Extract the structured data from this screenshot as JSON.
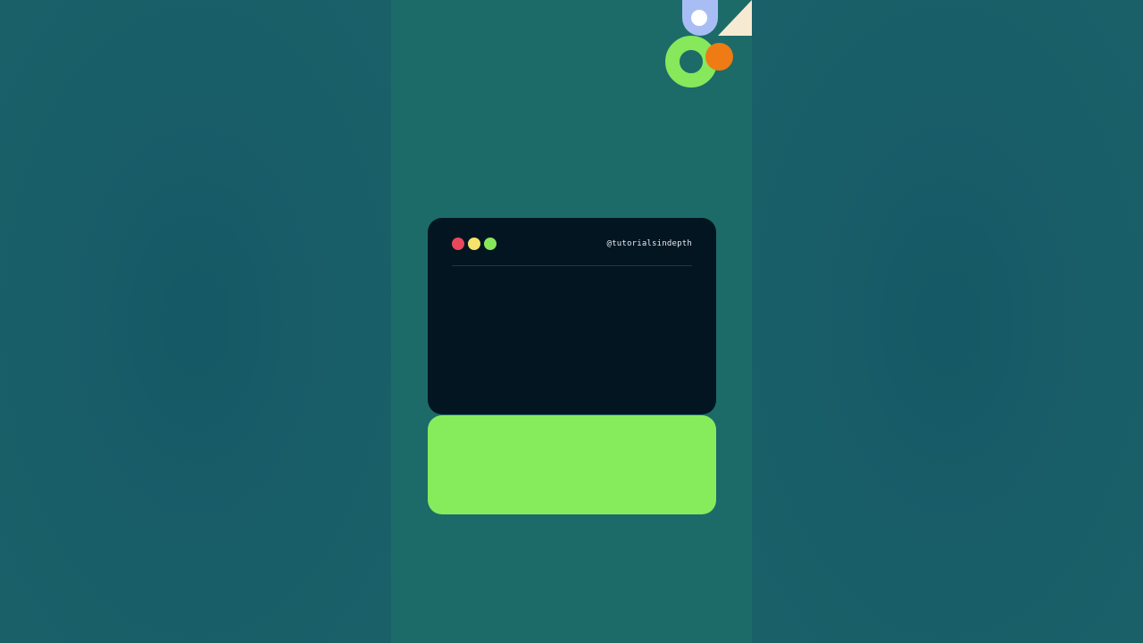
{
  "terminal": {
    "handle": "@tutorialsindepth",
    "traffic_lights": [
      {
        "name": "close",
        "color": "#e8485c"
      },
      {
        "name": "minimize",
        "color": "#f6e26b"
      },
      {
        "name": "maximize",
        "color": "#86e85a"
      }
    ],
    "background_color": "#021521"
  },
  "theme": {
    "stage_color": "#1c6b69",
    "side_color": "#175a64",
    "accent_green": "#86ec5c",
    "accent_orange": "#ee7b13",
    "accent_blue": "#a9bdf5",
    "accent_cream": "#f7ead2"
  },
  "icons": [
    "location-pin-icon",
    "triangle-shape",
    "ring-shape",
    "orange-dot-shape"
  ]
}
